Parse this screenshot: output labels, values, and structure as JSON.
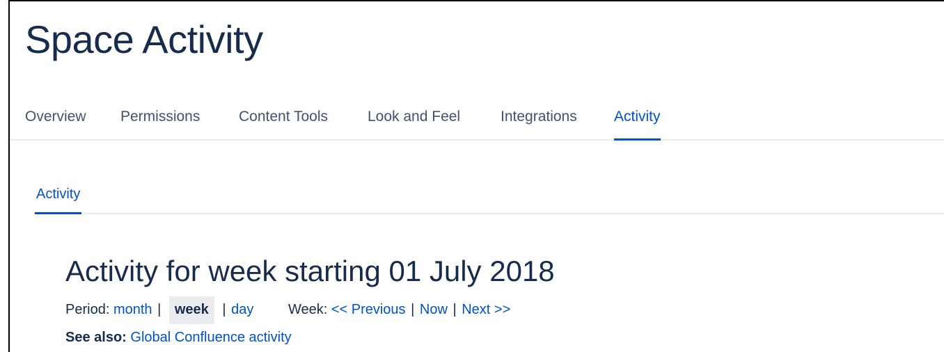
{
  "header": {
    "title": "Space Activity"
  },
  "main_tabs": [
    {
      "label": "Overview",
      "active": false
    },
    {
      "label": "Permissions",
      "active": false
    },
    {
      "label": "Content Tools",
      "active": false
    },
    {
      "label": "Look and Feel",
      "active": false
    },
    {
      "label": "Integrations",
      "active": false
    },
    {
      "label": "Activity",
      "active": true
    }
  ],
  "sub_tabs": [
    {
      "label": "Activity",
      "active": true
    }
  ],
  "activity": {
    "heading": "Activity for week starting 01 July 2018",
    "period_label": "Period:",
    "period_options": {
      "month": "month",
      "week": "week",
      "day": "day"
    },
    "selected_period": "week",
    "week_label": "Week:",
    "week_nav": {
      "previous": "<< Previous",
      "now": "Now",
      "next": "Next >>"
    },
    "separator": "|",
    "see_also_label": "See also:",
    "see_also_link": "Global Confluence activity"
  },
  "colors": {
    "link": "#0052cc",
    "text": "#172b4d",
    "tab_text": "#42526e",
    "divider": "#e9ebef",
    "selected_bg": "#ebecf0"
  }
}
